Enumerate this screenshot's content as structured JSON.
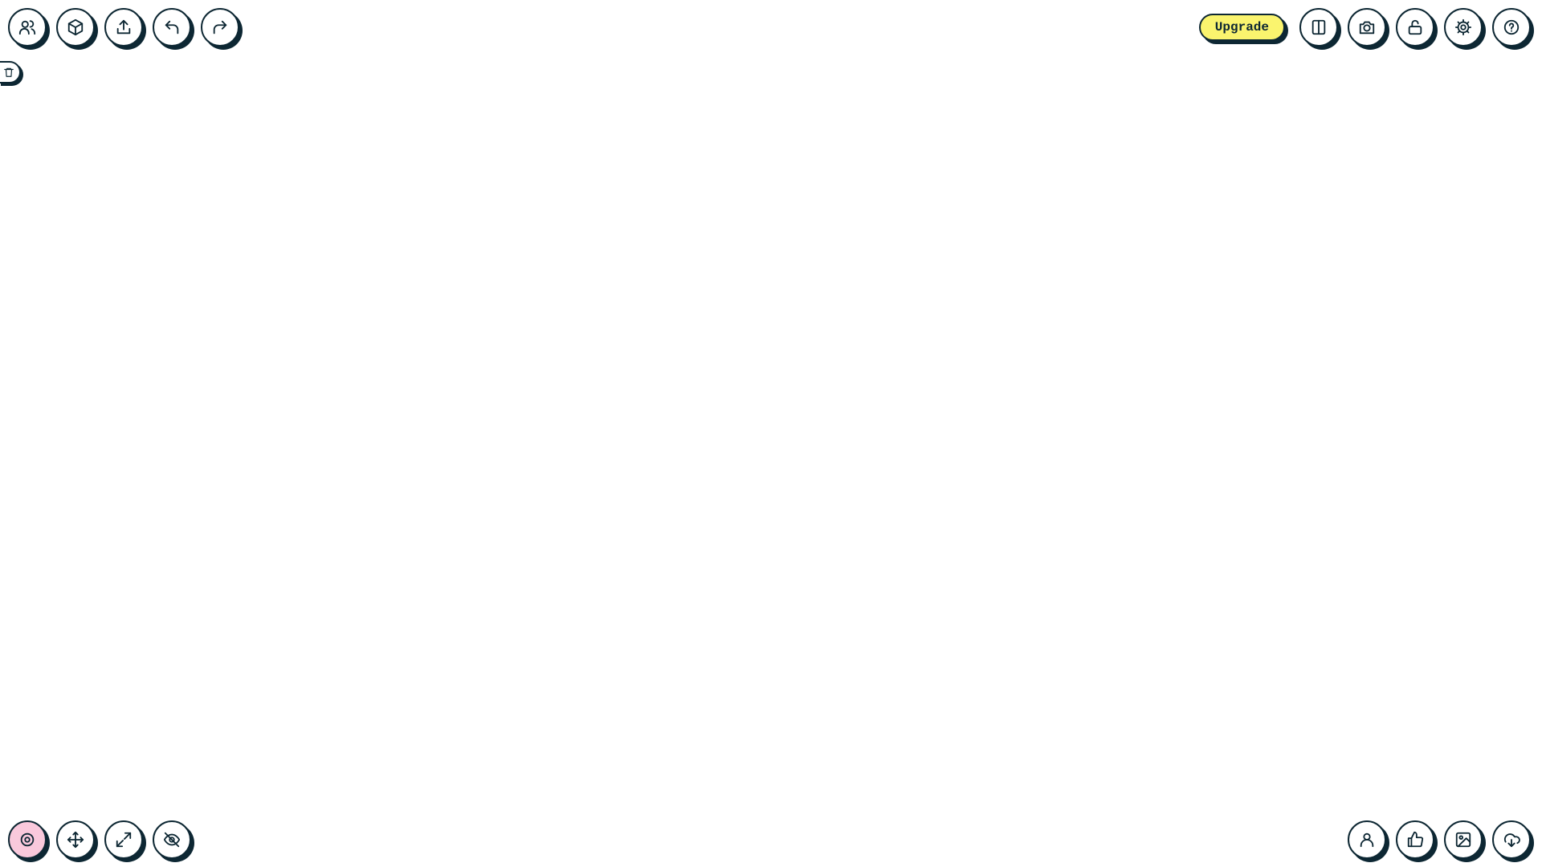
{
  "canvas": {
    "background": "#ffffff"
  },
  "top_left": {
    "buttons": [
      {
        "icon": "users-icon"
      },
      {
        "icon": "cube-icon"
      },
      {
        "icon": "upload-icon"
      },
      {
        "icon": "undo-icon"
      },
      {
        "icon": "redo-icon"
      }
    ]
  },
  "side": {
    "icon": "trash-icon"
  },
  "top_right": {
    "upgrade_label": "Upgrade",
    "upgrade_color": "#faf46e",
    "buttons": [
      {
        "icon": "split-view-icon"
      },
      {
        "icon": "camera-icon"
      },
      {
        "icon": "unlock-icon"
      },
      {
        "icon": "gear-icon"
      },
      {
        "icon": "help-icon"
      }
    ]
  },
  "bottom_left": {
    "buttons": [
      {
        "icon": "target-icon",
        "active": true,
        "active_color": "#f9c9dc"
      },
      {
        "icon": "move-icon"
      },
      {
        "icon": "expand-icon"
      },
      {
        "icon": "eye-off-icon"
      }
    ]
  },
  "bottom_right": {
    "buttons": [
      {
        "icon": "user-icon"
      },
      {
        "icon": "thumbs-up-icon"
      },
      {
        "icon": "image-icon"
      },
      {
        "icon": "cloud-download-icon"
      }
    ]
  },
  "colors": {
    "ink": "#0d2733"
  }
}
